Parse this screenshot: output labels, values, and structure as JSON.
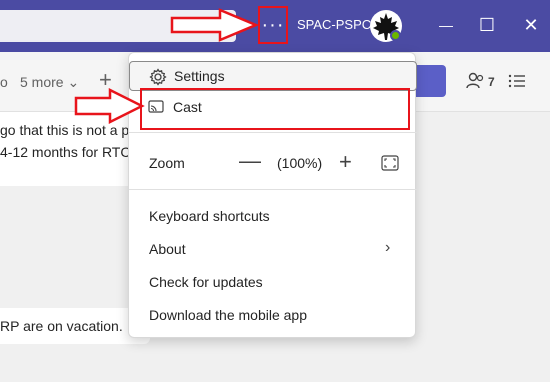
{
  "titlebar": {
    "org_name": "SPAC-PSPC",
    "more_glyph": "···",
    "minimize_glyph": "—",
    "restore_glyph": "☐",
    "close_glyph": "✕"
  },
  "toolbar": {
    "partial_tab": "o",
    "more_tabs": "5 more ⌄",
    "add_glyph": "+",
    "participants_count": "7"
  },
  "chat": {
    "line1": "go that this is not a p",
    "line2": "4-12 months for RTC",
    "line3": "RP are on vacation."
  },
  "menu": {
    "settings": "Settings",
    "cast": "Cast",
    "zoom_label": "Zoom",
    "zoom_minus": "—",
    "zoom_value": "(100%)",
    "zoom_plus": "+",
    "keyboard_shortcuts": "Keyboard shortcuts",
    "about": "About",
    "about_chevron": "›",
    "check_updates": "Check for updates",
    "download_app": "Download the mobile app"
  },
  "colors": {
    "titlebar": "#4b4ba3",
    "accent": "#5b5fc7",
    "annotation_red": "#e8141b"
  }
}
